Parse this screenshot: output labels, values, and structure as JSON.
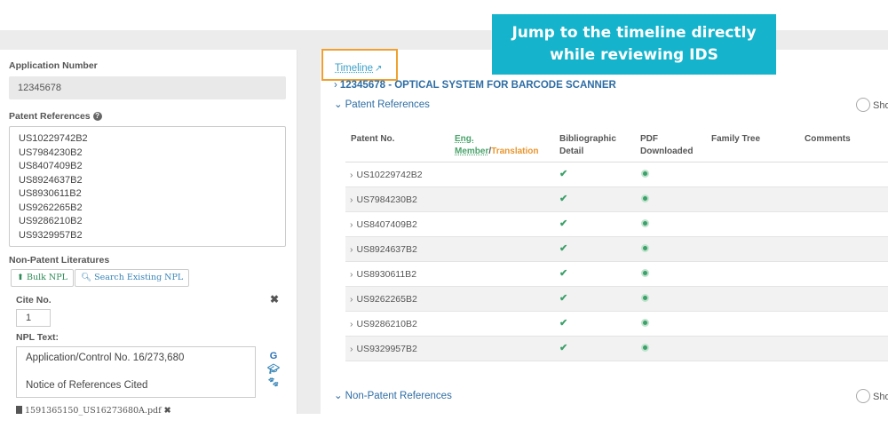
{
  "callout": {
    "line1": "Jump to the timeline directly",
    "line2": "while reviewing IDS"
  },
  "left": {
    "app_number_label": "Application Number",
    "app_number_value": "12345678",
    "patent_refs_label": "Patent References",
    "patent_refs": [
      "US10229742B2",
      "US7984230B2",
      "US8407409B2",
      "US8924637B2",
      "US8930611B2",
      "US9262265B2",
      "US9286210B2",
      "US9329957B2"
    ],
    "npl_label": "Non-Patent Literatures",
    "bulk_npl_label": "Bulk NPL",
    "search_npl_label": "Search Existing NPL",
    "cite_no_label": "Cite No.",
    "cite_no_value": "1",
    "npl_text_label": "NPL Text:",
    "npl_text_line1": "Application/Control No. 16/273,680",
    "npl_text_line2": "Notice of References Cited",
    "attachment_name": "1591365150_US16273680A.pdf"
  },
  "right": {
    "timeline_label": "Timeline",
    "app_title": "12345678 - OPTICAL SYSTEM FOR BARCODE SCANNER",
    "patent_refs_section": "Patent References",
    "npl_section": "Non-Patent References",
    "show_label": "Sho",
    "columns": {
      "patent_no": "Patent No.",
      "eng": "Eng.",
      "member": "Member",
      "slash": "/",
      "translation": "Translation",
      "biblio_1": "Bibliographic",
      "biblio_2": "Detail",
      "pdf_1": "PDF",
      "pdf_2": "Downloaded",
      "family_tree": "Family Tree",
      "comments": "Comments"
    },
    "rows": [
      "US10229742B2",
      "US7984230B2",
      "US8407409B2",
      "US8924637B2",
      "US8930611B2",
      "US9262265B2",
      "US9286210B2",
      "US9329957B2"
    ]
  },
  "colors": {
    "accent": "#15b4cc",
    "link": "#2e6da4",
    "highlight_border": "#f0a030",
    "check": "#3ca06a"
  }
}
